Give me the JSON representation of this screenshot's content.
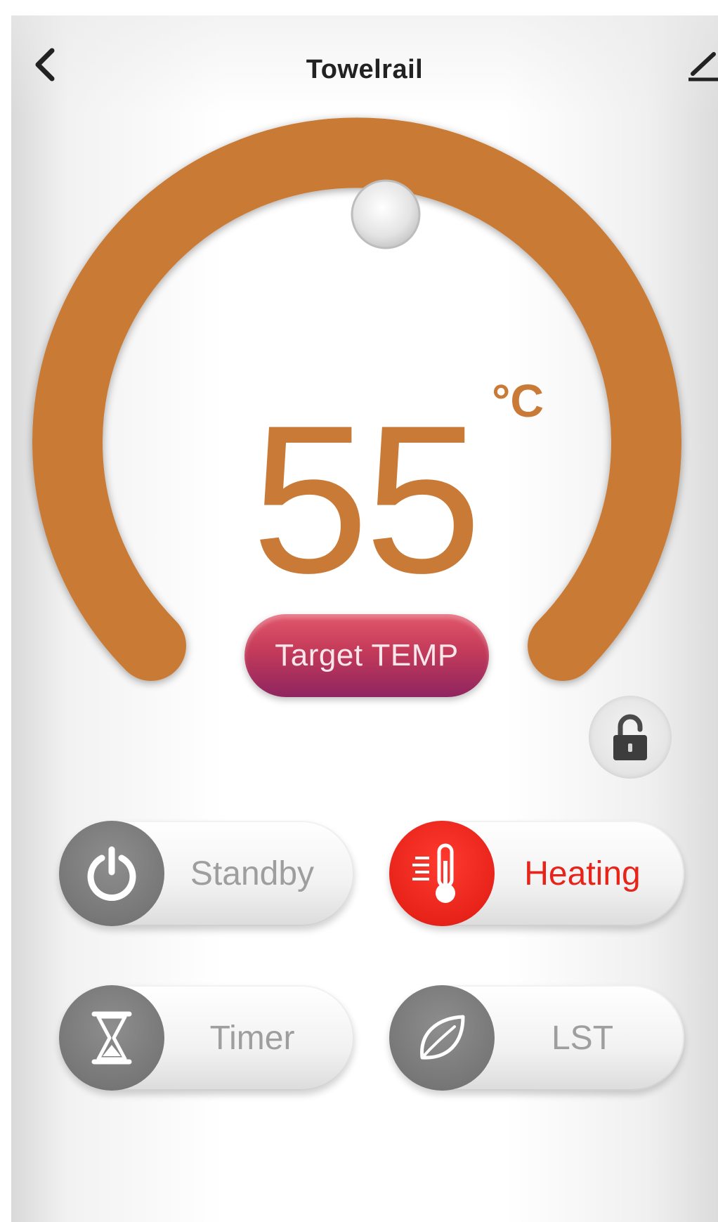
{
  "header": {
    "title": "Towelrail",
    "back_icon": "chevron-left-icon",
    "edit_icon": "pencil-icon"
  },
  "dial": {
    "value": "55",
    "unit": "°C",
    "accent_color": "#c97a36",
    "target_label": "Target TEMP"
  },
  "lock": {
    "icon": "unlocked-padlock-icon"
  },
  "modes": [
    {
      "label": "Standby",
      "icon": "power-icon",
      "active": false
    },
    {
      "label": "Heating",
      "icon": "thermometer-icon",
      "active": true,
      "color": "#e8231a"
    },
    {
      "label": "Timer",
      "icon": "hourglass-icon",
      "active": false
    },
    {
      "label": "LST",
      "icon": "leaf-icon",
      "active": false
    }
  ]
}
